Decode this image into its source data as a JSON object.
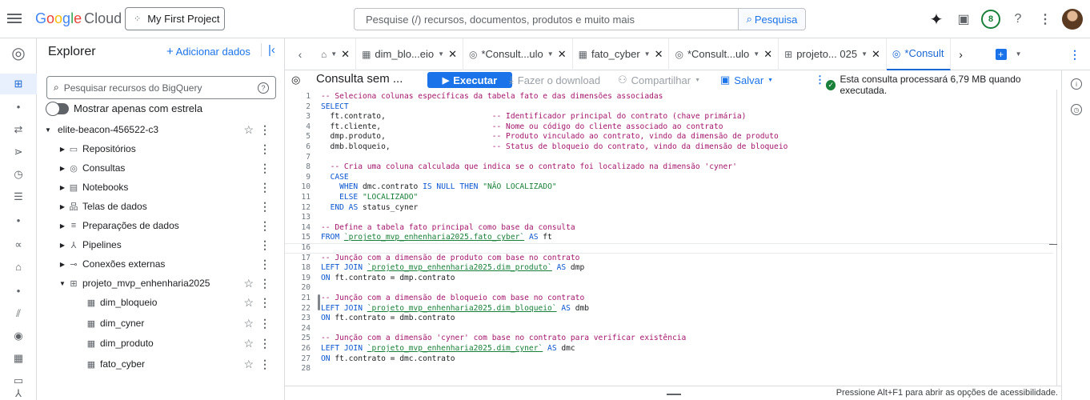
{
  "header": {
    "logo_google": "Google",
    "logo_cloud": "Cloud",
    "project": "My First Project",
    "search_placeholder": "Pesquise (/) recursos, documentos, produtos e muito mais",
    "search_button": "Pesquisa",
    "notifications_count": "8"
  },
  "explorer": {
    "title": "Explorer",
    "add_data": "Adicionar dados",
    "search_placeholder": "Pesquisar recursos do BigQuery",
    "starred_toggle": "Mostrar apenas com estrela",
    "project_id": "elite-beacon-456522-c3",
    "items": [
      {
        "label": "Repositórios",
        "icon": "folder-icon"
      },
      {
        "label": "Consultas",
        "icon": "query-icon"
      },
      {
        "label": "Notebooks",
        "icon": "notebook-icon"
      },
      {
        "label": "Telas de dados",
        "icon": "canvas-icon"
      },
      {
        "label": "Preparações de dados",
        "icon": "data-prep-icon"
      },
      {
        "label": "Pipelines",
        "icon": "pipeline-icon"
      },
      {
        "label": "Conexões externas",
        "icon": "connection-icon"
      }
    ],
    "dataset": "projeto_mvp_enhenharia2025",
    "tables": [
      "dim_bloqueio",
      "dim_cyner",
      "dim_produto",
      "fato_cyber"
    ]
  },
  "tabs": [
    {
      "label": "",
      "icon": "home-icon"
    },
    {
      "label": "dim_blo...eio",
      "icon": "table-icon"
    },
    {
      "label": "*Consult...ulo",
      "icon": "query-icon"
    },
    {
      "label": "fato_cyber",
      "icon": "table-icon"
    },
    {
      "label": "*Consult...ulo",
      "icon": "query-icon"
    },
    {
      "label": "projeto... 025",
      "icon": "dataset-icon"
    },
    {
      "label": "*Consult",
      "icon": "query-icon",
      "active": true
    }
  ],
  "toolbar": {
    "query_title": "Consulta sem ...",
    "run": "Executar",
    "download": "Fazer o download",
    "share": "Compartilhar",
    "save": "Salvar",
    "status": "Esta consulta processará 6,79 MB quando executada."
  },
  "code_lines": [
    "-- Seleciona colunas específicas da tabela fato e das dimensões associadas",
    "SELECT",
    "  ft.contrato,                       -- Identificador principal do contrato (chave primária)",
    "  ft.cliente,                        -- Nome ou código do cliente associado ao contrato",
    "  dmp.produto,                       -- Produto vinculado ao contrato, vindo da dimensão de produto",
    "  dmb.bloqueio,                      -- Status de bloqueio do contrato, vindo da dimensão de bloqueio",
    "",
    "  -- Cria uma coluna calculada que indica se o contrato foi localizado na dimensão 'cyner'",
    "  CASE",
    "    WHEN dmc.contrato IS NULL THEN \"NÃO LOCALIZADO\"",
    "    ELSE \"LOCALIZADO\"",
    "  END AS status_cyner",
    "",
    "-- Define a tabela fato principal como base da consulta",
    "FROM `projeto_mvp_enhenharia2025.fato_cyber` AS ft",
    "",
    "-- Junção com a dimensão de produto com base no contrato",
    "LEFT JOIN `projeto_mvp_enhenharia2025.dim_produto` AS dmp",
    "ON ft.contrato = dmp.contrato",
    "",
    "-- Junção com a dimensão de bloqueio com base no contrato",
    "LEFT JOIN `projeto_mvp_enhenharia2025.dim_bloqueio` AS dmb",
    "ON ft.contrato = dmb.contrato",
    "",
    "-- Junção com a dimensão 'cyner' com base no contrato para verificar existência",
    "LEFT JOIN `projeto_mvp_enhenharia2025.dim_cyner` AS dmc",
    "ON ft.contrato = dmc.contrato",
    ""
  ],
  "footer": {
    "a11y_hint": "Pressione Alt+F1 para abrir as opções de acessibilidade."
  },
  "colors": {
    "accent": "#1a73e8",
    "keyword": "#0b57d0",
    "comment": "#a3156b",
    "string": "#188038"
  }
}
